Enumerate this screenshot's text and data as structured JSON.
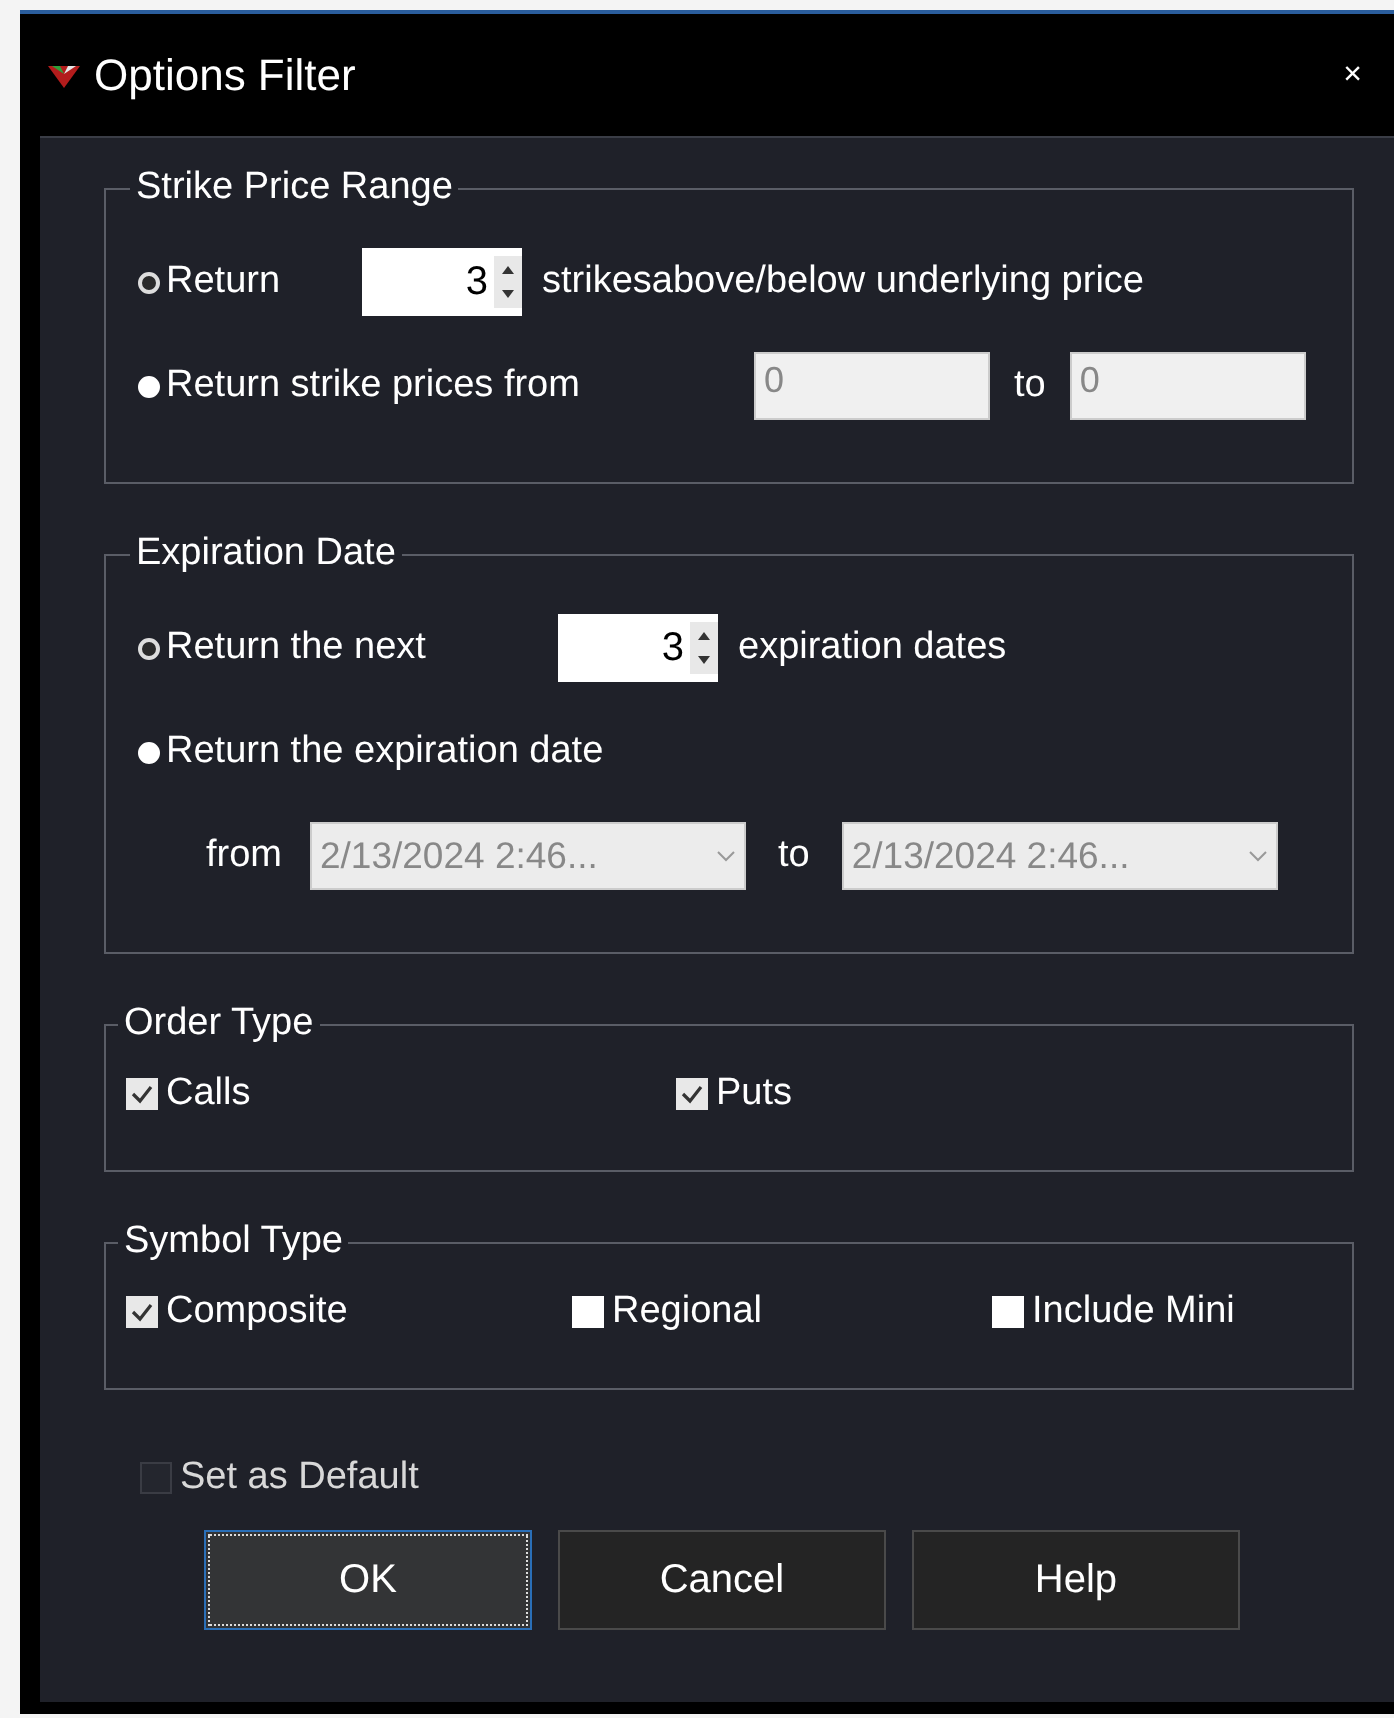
{
  "window": {
    "title": "Options Filter",
    "close": "×"
  },
  "strike_price_range": {
    "title": "Strike Price Range",
    "options": [
      {
        "label": "Return",
        "selected": true,
        "spin_value": "3",
        "after": "strikesabove/below underlying price"
      },
      {
        "label": "Return strike prices from",
        "selected": false,
        "from_value": "0",
        "to_label": "to",
        "to_value": "0"
      }
    ]
  },
  "expiration_date": {
    "title": "Expiration Date",
    "options": [
      {
        "label": "Return the next",
        "selected": true,
        "spin_value": "3",
        "after": "expiration dates"
      },
      {
        "label": "Return the expiration date",
        "selected": false
      }
    ],
    "from_label": "from",
    "from_value": "2/13/2024 2:46...",
    "to_label": "to",
    "to_value": "2/13/2024 2:46..."
  },
  "order_type": {
    "title": "Order Type",
    "items": [
      {
        "label": "Calls",
        "checked": true
      },
      {
        "label": "Puts",
        "checked": true
      }
    ]
  },
  "symbol_type": {
    "title": "Symbol Type",
    "items": [
      {
        "label": "Composite",
        "checked": true
      },
      {
        "label": "Regional",
        "checked": false
      },
      {
        "label": "Include Mini",
        "checked": false
      }
    ]
  },
  "set_as_default": {
    "label": "Set as Default",
    "checked": false,
    "disabled": true
  },
  "buttons": [
    {
      "label": "OK",
      "focused": true
    },
    {
      "label": "Cancel",
      "focused": false
    },
    {
      "label": "Help",
      "focused": false
    }
  ]
}
